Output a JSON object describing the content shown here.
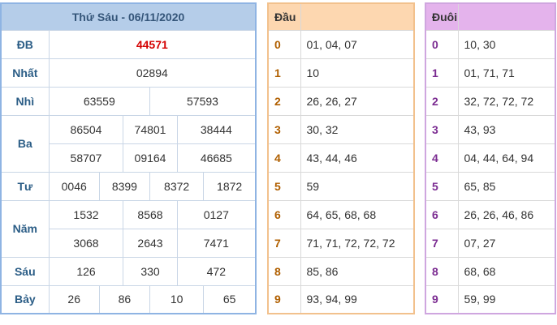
{
  "title": "Thứ Sáu - 06/11/2020",
  "prizes": {
    "db": {
      "label": "ĐB",
      "numbers": [
        "44571"
      ]
    },
    "nhat": {
      "label": "Nhất",
      "numbers": [
        "02894"
      ]
    },
    "nhi": {
      "label": "Nhì",
      "numbers": [
        "63559",
        "57593"
      ]
    },
    "ba": {
      "label": "Ba",
      "numbers": [
        "86504",
        "74801",
        "38444",
        "58707",
        "09164",
        "46685"
      ]
    },
    "tu": {
      "label": "Tư",
      "numbers": [
        "0046",
        "8399",
        "8372",
        "1872"
      ]
    },
    "nam": {
      "label": "Năm",
      "numbers": [
        "1532",
        "8568",
        "0127",
        "3068",
        "2643",
        "7471"
      ]
    },
    "sau": {
      "label": "Sáu",
      "numbers": [
        "126",
        "330",
        "472"
      ]
    },
    "bay": {
      "label": "Bảy",
      "numbers": [
        "26",
        "86",
        "10",
        "65"
      ]
    }
  },
  "dau": {
    "header": "Đầu",
    "rows": [
      {
        "digit": "0",
        "values": "01, 04, 07"
      },
      {
        "digit": "1",
        "values": "10"
      },
      {
        "digit": "2",
        "values": "26, 26, 27"
      },
      {
        "digit": "3",
        "values": "30, 32"
      },
      {
        "digit": "4",
        "values": "43, 44, 46"
      },
      {
        "digit": "5",
        "values": "59"
      },
      {
        "digit": "6",
        "values": "64, 65, 68, 68"
      },
      {
        "digit": "7",
        "values": "71, 71, 72, 72, 72"
      },
      {
        "digit": "8",
        "values": "85, 86"
      },
      {
        "digit": "9",
        "values": "93, 94, 99"
      }
    ]
  },
  "duoi": {
    "header": "Đuôi",
    "rows": [
      {
        "digit": "0",
        "values": "10, 30"
      },
      {
        "digit": "1",
        "values": "01, 71, 71"
      },
      {
        "digit": "2",
        "values": "32, 72, 72, 72"
      },
      {
        "digit": "3",
        "values": "43, 93"
      },
      {
        "digit": "4",
        "values": "04, 44, 64, 94"
      },
      {
        "digit": "5",
        "values": "65, 85"
      },
      {
        "digit": "6",
        "values": "26, 26, 46, 86"
      },
      {
        "digit": "7",
        "values": "07, 27"
      },
      {
        "digit": "8",
        "values": "68, 68"
      },
      {
        "digit": "9",
        "values": "59, 99"
      }
    ]
  },
  "colors": {
    "results_border": "#8fb4e3",
    "results_header": "#b5cde9",
    "special_prize": "#d40000",
    "dau_header": "#fdd7b0",
    "duoi_header": "#e4b3ec"
  }
}
